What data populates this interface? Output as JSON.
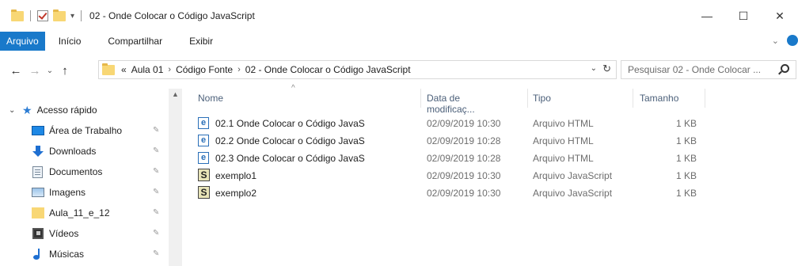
{
  "window": {
    "title": "02 - Onde Colocar o Código JavaScript",
    "controls": {
      "minimize": "—",
      "maximize": "☐",
      "close": "✕"
    }
  },
  "ribbon": {
    "file_tab": "Arquivo",
    "tabs": [
      "Início",
      "Compartilhar",
      "Exibir"
    ]
  },
  "address_bar": {
    "prefix": "«",
    "parts": [
      "Aula 01",
      "Código Fonte",
      "02 - Onde Colocar o Código JavaScript"
    ],
    "separator": "›"
  },
  "search": {
    "placeholder": "Pesquisar 02 - Onde Colocar ..."
  },
  "nav_pane": {
    "quick_access": "Acesso rápido",
    "items": [
      {
        "label": "Área de Trabalho",
        "icon": "desktop-icon"
      },
      {
        "label": "Downloads",
        "icon": "downloads-icon"
      },
      {
        "label": "Documentos",
        "icon": "documents-icon"
      },
      {
        "label": "Imagens",
        "icon": "pictures-icon"
      },
      {
        "label": "Aula_11_e_12",
        "icon": "folder-icon"
      },
      {
        "label": "Vídeos",
        "icon": "videos-icon"
      },
      {
        "label": "Músicas",
        "icon": "music-icon"
      }
    ]
  },
  "file_list": {
    "columns": [
      "Nome",
      "Data de modificaç...",
      "Tipo",
      "Tamanho"
    ],
    "rows": [
      {
        "name": "02.1 Onde Colocar o Código JavaS",
        "date": "02/09/2019 10:30",
        "type": "Arquivo HTML",
        "size": "1 KB",
        "icon": "html-file-icon"
      },
      {
        "name": "02.2 Onde Colocar o Código JavaS",
        "date": "02/09/2019 10:28",
        "type": "Arquivo HTML",
        "size": "1 KB",
        "icon": "html-file-icon"
      },
      {
        "name": "02.3 Onde Colocar o Código JavaS",
        "date": "02/09/2019 10:28",
        "type": "Arquivo HTML",
        "size": "1 KB",
        "icon": "html-file-icon"
      },
      {
        "name": "exemplo1",
        "date": "02/09/2019 10:30",
        "type": "Arquivo JavaScript",
        "size": "1 KB",
        "icon": "js-file-icon"
      },
      {
        "name": "exemplo2",
        "date": "02/09/2019 10:30",
        "type": "Arquivo JavaScript",
        "size": "1 KB",
        "icon": "js-file-icon"
      }
    ]
  },
  "colors": {
    "accent": "#1979ca",
    "folder": "#f8d775",
    "header_text": "#4c607a"
  }
}
